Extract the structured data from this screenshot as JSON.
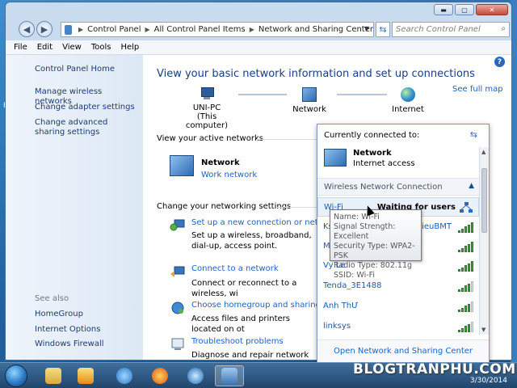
{
  "window": {
    "minimize_glyph": "▬",
    "maximize_glyph": "▢",
    "close_glyph": "✕"
  },
  "address": {
    "breadcrumb": [
      "Control Panel",
      "All Control Panel Items",
      "Network and Sharing Center"
    ],
    "search_placeholder": "Search Control Panel"
  },
  "menu": [
    "File",
    "Edit",
    "View",
    "Tools",
    "Help"
  ],
  "sidebar": {
    "links": [
      "Control Panel Home",
      "Manage wireless networks",
      "Change adapter settings",
      "Change advanced sharing settings"
    ],
    "see_also_label": "See also",
    "see_also": [
      "HomeGroup",
      "Internet Options",
      "Windows Firewall"
    ]
  },
  "main": {
    "title": "View your basic network information and set up connections",
    "see_full_map": "See full map",
    "map": {
      "computer_name": "UNI-PC",
      "computer_sub": "(This computer)",
      "network": "Network",
      "internet": "Internet"
    },
    "active_networks_label": "View your active networks",
    "active_network": {
      "name": "Network",
      "type": "Work network"
    },
    "settings_label": "Change your networking settings",
    "tasks": [
      {
        "title": "Set up a new connection or network",
        "desc": "Set up a wireless, broadband, dial-up, access point."
      },
      {
        "title": "Connect to a network",
        "desc": "Connect or reconnect to a wireless, wi"
      },
      {
        "title": "Choose homegroup and sharing optio",
        "desc": "Access files and printers located on ot"
      },
      {
        "title": "Troubleshoot problems",
        "desc": "Diagnose and repair network problem"
      }
    ]
  },
  "flyout": {
    "header": "Currently connected to:",
    "connected_name": "Network",
    "connected_status": "Internet access",
    "section": "Wireless Network Connection",
    "networks": [
      {
        "name": "Wi-Fi",
        "status": "Waiting for users",
        "signal": 5
      },
      {
        "name": "Ks",
        "status": "yLieuBMT",
        "signal": 5
      },
      {
        "name": "M",
        "status": "",
        "signal": 5
      },
      {
        "name": "Vy Le",
        "status": "",
        "signal": 5
      },
      {
        "name": "Tenda_3E1488",
        "status": "",
        "signal": 4
      },
      {
        "name": "Anh ThƯ",
        "status": "",
        "signal": 4
      },
      {
        "name": "linksys",
        "status": "",
        "signal": 4
      }
    ],
    "footer": "Open Network and Sharing Center"
  },
  "tooltip": [
    "Name: Wi-Fi",
    "Signal Strength: Excellent",
    "Security Type: WPA2-PSK",
    "Radio Type: 802.11g",
    "SSID: Wi-Fi"
  ],
  "taskbar": {
    "brand": "BLOGTRANPHU.COM",
    "date": "3/30/2014"
  },
  "desktop": {
    "edge_text": "Ri"
  }
}
